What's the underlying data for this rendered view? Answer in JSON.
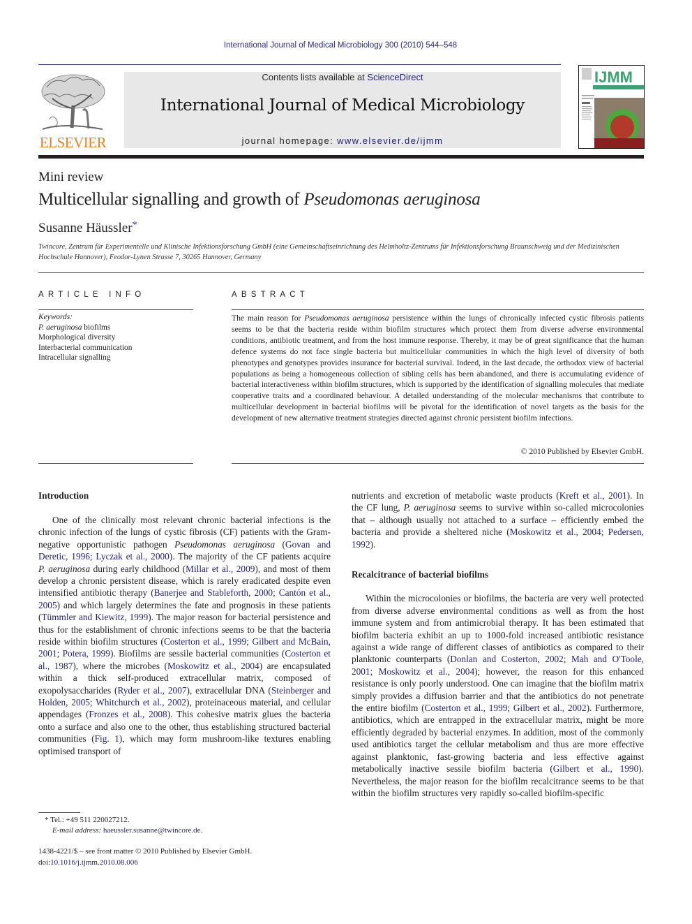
{
  "running_head": "International Journal of Medical Microbiology 300 (2010) 544–548",
  "publisher": {
    "name": "ELSEVIER",
    "brand_color": "#f07e1b"
  },
  "banner": {
    "contents_prefix": "Contents lists available at ",
    "contents_link": "ScienceDirect",
    "journal_title": "International Journal of Medical Microbiology",
    "homepage_prefix": "journal homepage: ",
    "homepage_link": "www.elsevier.de/ijmm"
  },
  "cover": {
    "logo_text": "IJMM",
    "accent_color": "#3aa373"
  },
  "article": {
    "type": "Mini review",
    "title_plain": "Multicellular signalling and growth of ",
    "title_italic": "Pseudomonas aeruginosa",
    "author": "Susanne Häussler",
    "author_mark": "*",
    "affiliation": "Twincore, Zentrum für Experimentelle und Klinische Infektionsforschung GmbH (eine Gemeinschaftseinrichtung des Helmholtz-Zentrums für Infektionsforschung Braunschweig und der Medizinischen Hochschule Hannover), Feodor-Lynen Strasse 7, 30265 Hannover, Germany"
  },
  "article_info": {
    "heading": "ARTICLE INFO",
    "keywords_label": "Keywords:",
    "keywords": [
      {
        "italic": "P. aeruginosa",
        "text": " biofilms"
      },
      {
        "italic": "",
        "text": "Morphological diversity"
      },
      {
        "italic": "",
        "text": "Interbacterial communication"
      },
      {
        "italic": "",
        "text": "Intracellular signalling"
      }
    ]
  },
  "abstract": {
    "heading": "ABSTRACT",
    "p1": "The main reason for ",
    "p1_italic": "Pseudomonas aeruginosa",
    "p1_rest": " persistence within the lungs of chronically infected cystic fibrosis patients seems to be that the bacteria reside within biofilm structures which protect them from diverse adverse environmental conditions, antibiotic treatment, and from the host immune response. Thereby, it may be of great significance that the human defence systems do not face single bacteria but multicellular communities in which the high level of diversity of both phenotypes and genotypes provides insurance for bacterial survival. Indeed, in the last decade, the orthodox view of bacterial populations as being a homogeneous collection of sibling cells has been abandoned, and there is accumulating evidence of bacterial interactiveness within biofilm structures, which is supported by the identification of signalling molecules that mediate cooperative traits and a coordinated behaviour. A detailed understanding of the molecular mechanisms that contribute to multicellular development in bacterial biofilms will be pivotal for the identification of novel targets as the basis for the development of new alternative treatment strategies directed against chronic persistent biofilm infections.",
    "copyright": "© 2010 Published by Elsevier GmbH."
  },
  "body": {
    "intro_heading": "Introduction",
    "intro": [
      {
        "t": "One of the clinically most relevant chronic bacterial infections is the chronic infection of the lungs of cystic fibrosis (CF) patients with the Gram-negative opportunistic pathogen "
      },
      {
        "i": "Pseudomonas aeruginosa"
      },
      {
        "t": " ("
      },
      {
        "l": "Govan and Deretic, 1996; Lyczak et al., 2000"
      },
      {
        "t": "). The majority of the CF patients acquire "
      },
      {
        "i": "P. aeruginosa"
      },
      {
        "t": " during early childhood ("
      },
      {
        "l": "Millar et al., 2009"
      },
      {
        "t": "), and most of them develop a chronic persistent disease, which is rarely eradicated despite even intensified antibiotic therapy ("
      },
      {
        "l": "Banerjee and Stableforth, 2000; Cantón et al., 2005"
      },
      {
        "t": ") and which largely determines the fate and prognosis in these patients ("
      },
      {
        "l": "Tümmler and Kiewitz, 1999"
      },
      {
        "t": "). The major reason for bacterial persistence and thus for the establishment of chronic infections seems to be that the bacteria reside within biofilm structures ("
      },
      {
        "l": "Costerton et al., 1999; Gilbert and McBain, 2001; Potera, 1999"
      },
      {
        "t": "). Biofilms are sessile bacterial communities ("
      },
      {
        "l": "Costerton et al., 1987"
      },
      {
        "t": "), where the microbes ("
      },
      {
        "l": "Moskowitz et al., 2004"
      },
      {
        "t": ") are encapsulated within a thick self-produced extracellular matrix, composed of exopolysaccharides ("
      },
      {
        "l": "Ryder et al., 2007"
      },
      {
        "t": "), extracellular DNA ("
      },
      {
        "l": "Steinberger and Holden, 2005; Whitchurch et al., 2002"
      },
      {
        "t": "), proteinaceous material, and cellular appendages ("
      },
      {
        "l": "Fronzes et al., 2008"
      },
      {
        "t": "). This cohesive matrix glues the bacteria onto a surface and also one to the other, thus establishing structured bacterial communities ("
      },
      {
        "l": "Fig. 1"
      },
      {
        "t": "), which may form mushroom-like textures enabling optimised transport of "
      }
    ],
    "intro_cont": [
      {
        "t": "nutrients and excretion of metabolic waste products ("
      },
      {
        "l": "Kreft et al., 2001"
      },
      {
        "t": "). In the CF lung, "
      },
      {
        "i": "P. aeruginosa"
      },
      {
        "t": " seems to survive within so-called microcolonies that – although usually not attached to a surface – efficiently embed the bacteria and provide a sheltered niche ("
      },
      {
        "l": "Moskowitz et al., 2004; Pedersen, 1992"
      },
      {
        "t": ")."
      }
    ],
    "recalc_heading": "Recalcitrance of bacterial biofilms",
    "recalc": [
      {
        "t": "Within the microcolonies or biofilms, the bacteria are very well protected from diverse adverse environmental conditions as well as from the host immune system and from antimicrobial therapy. It has been estimated that biofilm bacteria exhibit an up to 1000-fold increased antibiotic resistance against a wide range of different classes of antibiotics as compared to their planktonic counterparts ("
      },
      {
        "l": "Donlan and Costerton, 2002; Mah and O'Toole, 2001; Moskowitz et al., 2004"
      },
      {
        "t": "); however, the reason for this enhanced resistance is only poorly understood. One can imagine that the biofilm matrix simply provides a diffusion barrier and that the antibiotics do not penetrate the entire biofilm ("
      },
      {
        "l": "Costerton et al., 1999; Gilbert et al., 2002"
      },
      {
        "t": "). Furthermore, antibiotics, which are entrapped in the extracellular matrix, might be more efficiently degraded by bacterial enzymes. In addition, most of the commonly used antibiotics target the cellular metabolism and thus are more effective against planktonic, fast-growing bacteria and less effective against metabolically inactive sessile biofilm bacteria ("
      },
      {
        "l": "Gilbert et al., 1990"
      },
      {
        "t": "). Nevertheless, the major reason for the biofilm recalcitrance seems to be that within the biofilm structures very rapidly so-called biofilm-specific"
      }
    ]
  },
  "footnote": {
    "mark": "*",
    "tel": "Tel.: +49 511 220027212.",
    "email_label": "E-mail address: ",
    "email": "haeussler.susanne@twincore.de",
    "email_suffix": "."
  },
  "front_matter": {
    "issn_line": "1438-4221/$ – see front matter © 2010 Published by Elsevier GmbH.",
    "doi_prefix": "doi:",
    "doi": "10.1016/j.ijmm.2010.08.006"
  }
}
